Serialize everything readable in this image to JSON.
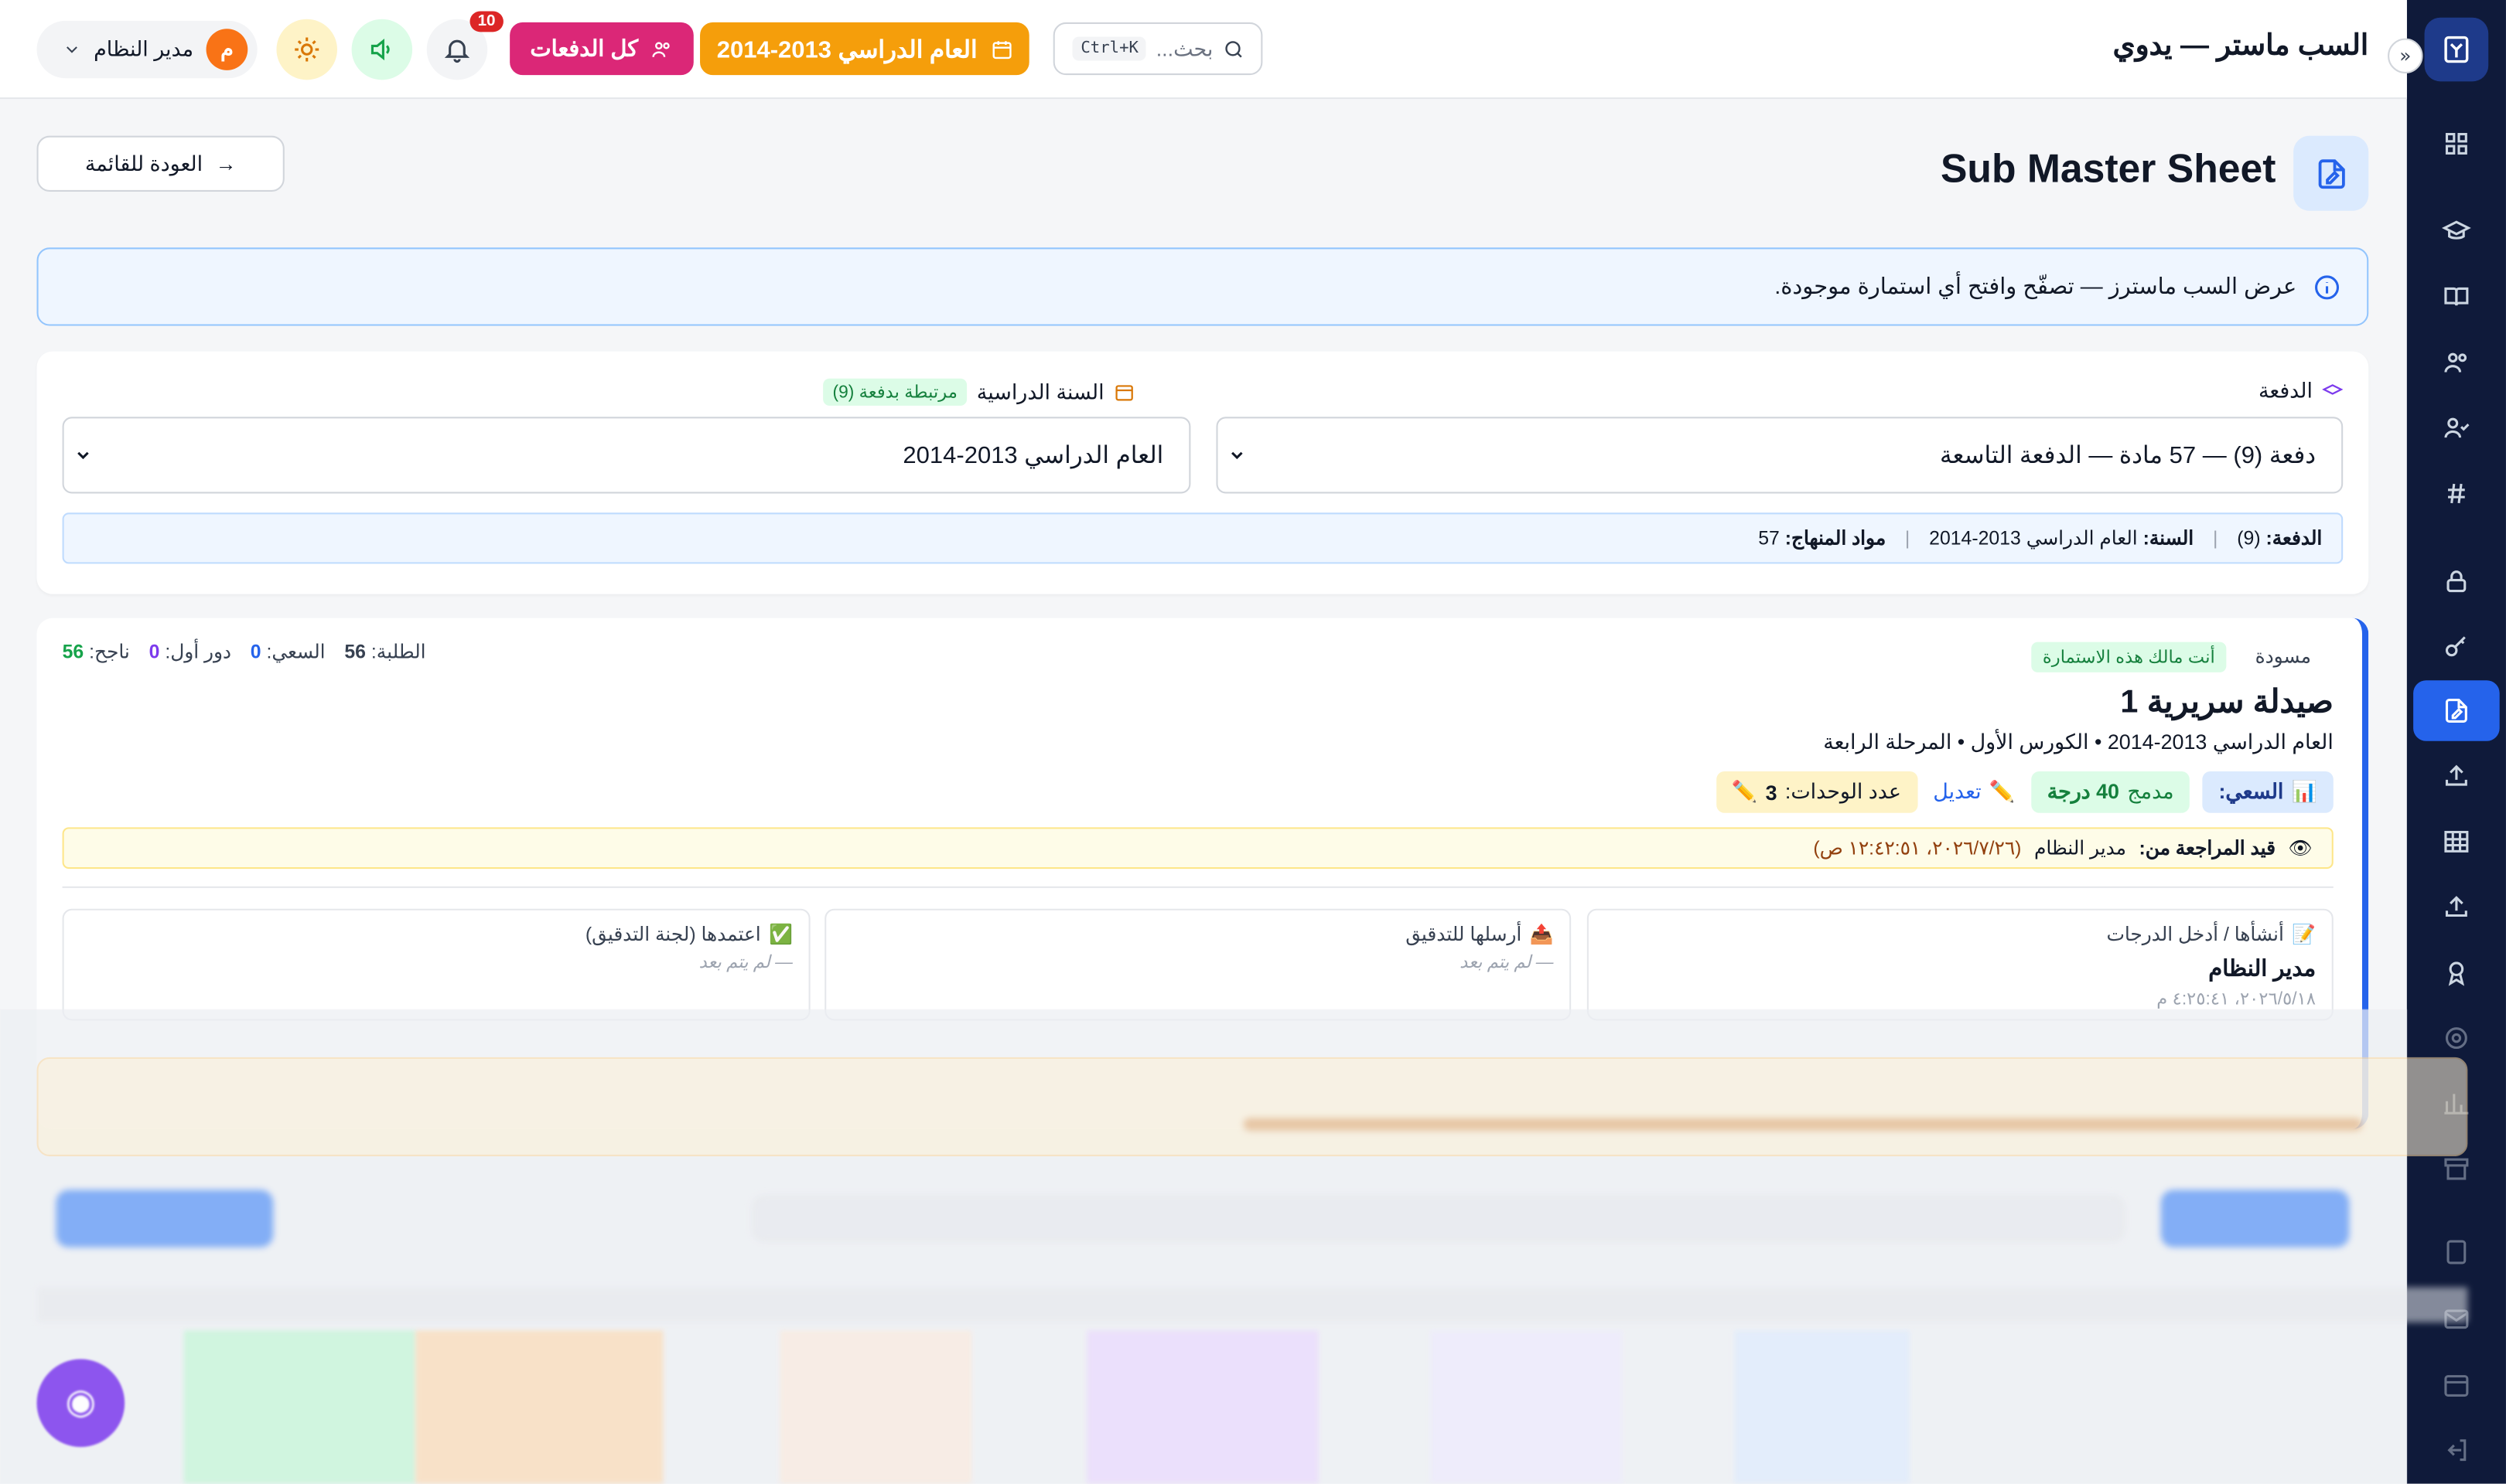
{
  "app": {
    "title": "السب ماستر — يدوي"
  },
  "topbar": {
    "search_placeholder": "بحث...",
    "search_shortcut": "Ctrl+K",
    "year_chip": "العام الدراسي 2013-2014",
    "batches_chip": "كل الدفعات",
    "notifications_count": "10",
    "user_name": "مدير النظام",
    "user_initial": "م"
  },
  "page": {
    "title": "Sub Master Sheet",
    "back_button": "العودة للقائمة",
    "info_text": "عرض السب ماسترز — تصفّح وافتح أي استمارة موجودة."
  },
  "filters": {
    "batch_label": "الدفعة",
    "batch_value": "دفعة (9) — 57 مادة — الدفعة التاسعة",
    "year_label": "السنة الدراسية",
    "year_tag": "مرتبطة بدفعة (9)",
    "year_value": "العام الدراسي 2013-2014",
    "summary": {
      "batch_key": "الدفعة:",
      "batch_val": "(9)",
      "year_key": "السنة:",
      "year_val": "العام الدراسي 2013-2014",
      "subjects_key": "مواد المنهاج:",
      "subjects_val": "57"
    }
  },
  "form": {
    "status": "مسودة",
    "owner_tag": "أنت مالك هذه الاستمارة",
    "title": "صيدلة سريرية 1",
    "meta": "العام الدراسي 2013-2014 • الكورس الأول • المرحلة الرابعة",
    "stats": {
      "students_label": "الطلبة:",
      "students_val": "56",
      "effort_label": "السعي:",
      "effort_val": "0",
      "round1_label": "دور أول:",
      "round1_val": "0",
      "passed_label": "ناجح:",
      "passed_val": "56"
    },
    "badges": {
      "effort": "السعي:",
      "merged": "مدمج",
      "merged_val": "40 درجة",
      "edit": "تعديل",
      "units_label": "عدد الوحدات:",
      "units_val": "3"
    },
    "review": {
      "label": "قيد المراجعة من:",
      "by": "مدير النظام",
      "time": "(٢٠٢٦/٧/٢٦، ١٢:٤٢:٥١ ص)"
    },
    "steps": [
      {
        "header": "أنشأها / أدخل الدرجات",
        "name": "مدير النظام",
        "sub": "٢٠٢٦/٥/١٨، ٤:٢٥:٤١ م"
      },
      {
        "header": "أرسلها للتدقيق",
        "name": "",
        "sub": "— لم يتم بعد"
      },
      {
        "header": "اعتمدها (لجنة التدقيق)",
        "name": "",
        "sub": "— لم يتم بعد"
      }
    ]
  },
  "colors": {
    "sidebar": "#0f1a3a",
    "accent": "#2563eb",
    "year_chip": "#f59e0b",
    "batches_chip": "#db2777"
  }
}
